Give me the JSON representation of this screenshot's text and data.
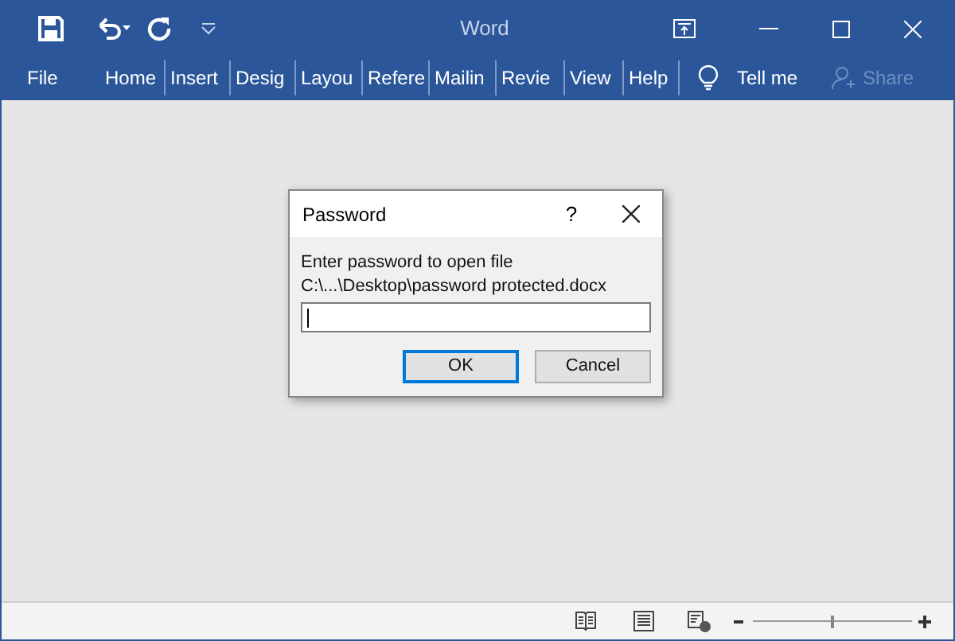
{
  "window": {
    "title": "Word"
  },
  "ribbon_tabs": [
    {
      "label": "File"
    },
    {
      "label": "Home"
    },
    {
      "label": "Insert"
    },
    {
      "label": "Desig"
    },
    {
      "label": "Layou"
    },
    {
      "label": "Refere"
    },
    {
      "label": "Mailin"
    },
    {
      "label": "Revie"
    },
    {
      "label": "View"
    },
    {
      "label": "Help"
    }
  ],
  "tell_me": {
    "label": "Tell me"
  },
  "share": {
    "label": "Share",
    "disabled": true
  },
  "dialog": {
    "title": "Password",
    "help": "?",
    "message": "Enter password to open file",
    "path": "C:\\...\\Desktop\\password protected.docx",
    "buttons": [
      {
        "label": "OK",
        "default": true
      },
      {
        "label": "Cancel",
        "default": false
      }
    ]
  },
  "status_bar": {
    "zoom": {
      "level": 0.5
    }
  }
}
